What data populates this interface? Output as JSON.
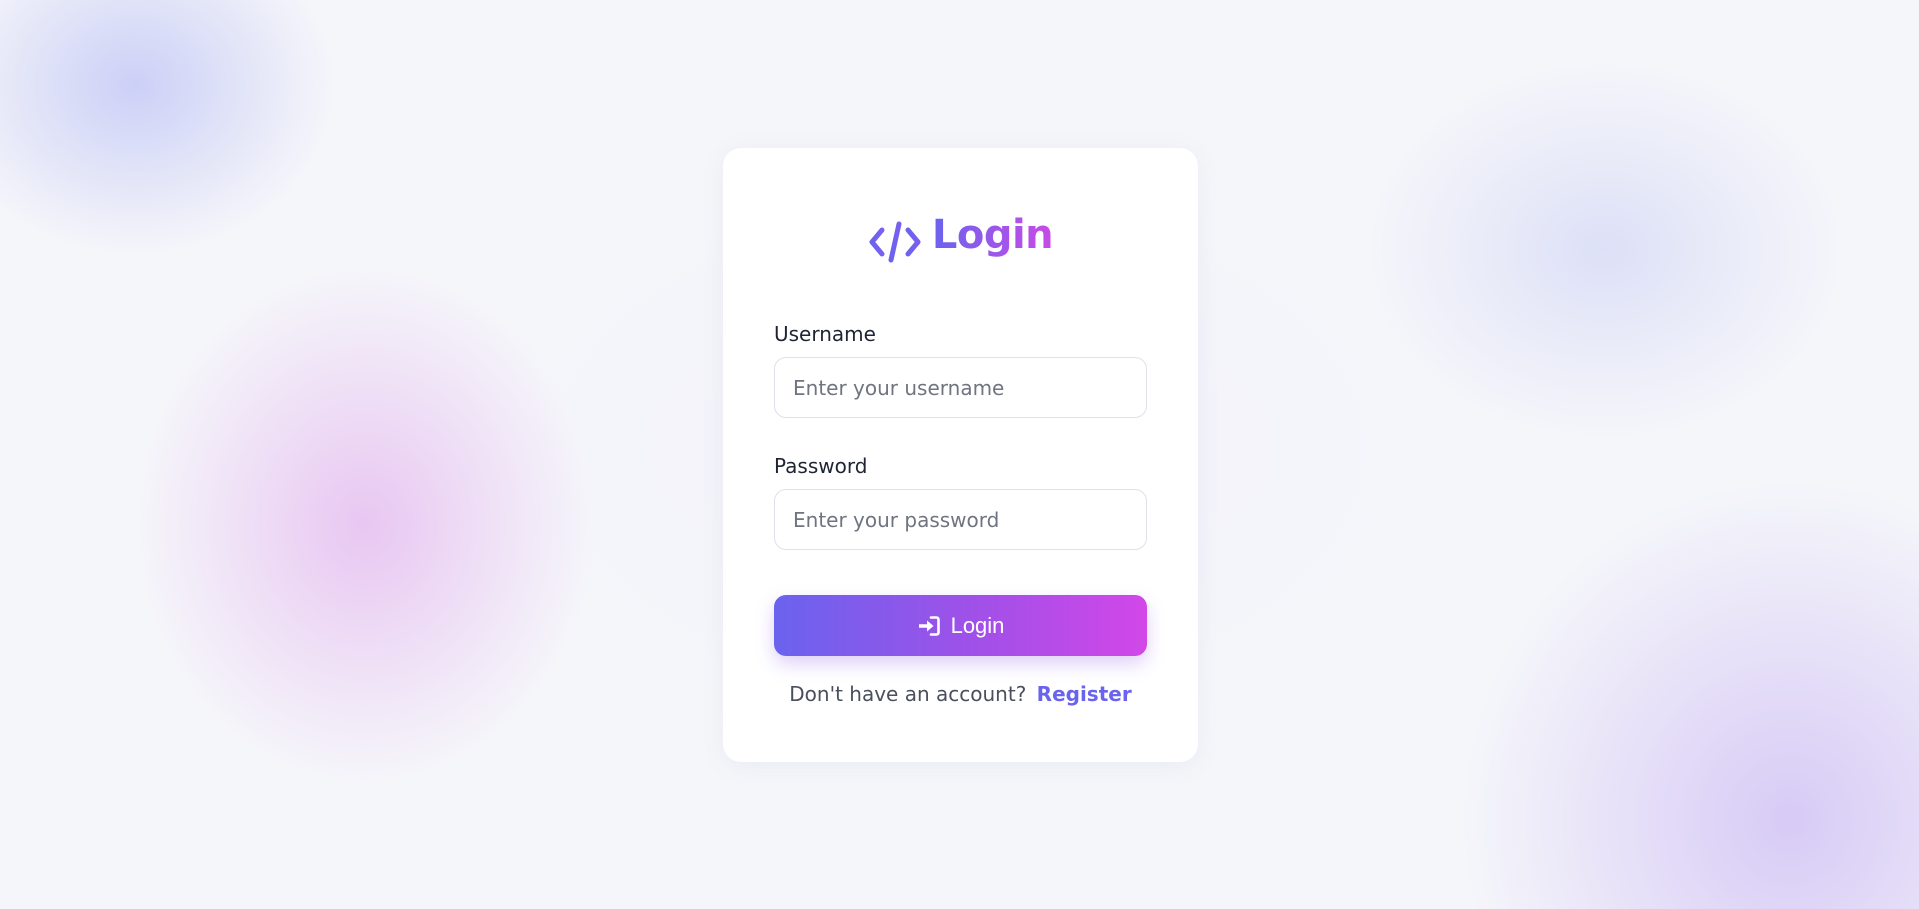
{
  "brand": {
    "icon": "code-icon",
    "title": "Login",
    "gradient_start": "#6a63ee",
    "gradient_end": "#c94be6"
  },
  "form": {
    "username": {
      "label": "Username",
      "placeholder": "Enter your username",
      "value": ""
    },
    "password": {
      "label": "Password",
      "placeholder": "Enter your password",
      "value": ""
    },
    "submit": {
      "icon": "sign-in-icon",
      "label": "Login"
    }
  },
  "footer": {
    "prompt": "Don't have an account?",
    "link_label": "Register",
    "link_color": "#6a63ee"
  }
}
